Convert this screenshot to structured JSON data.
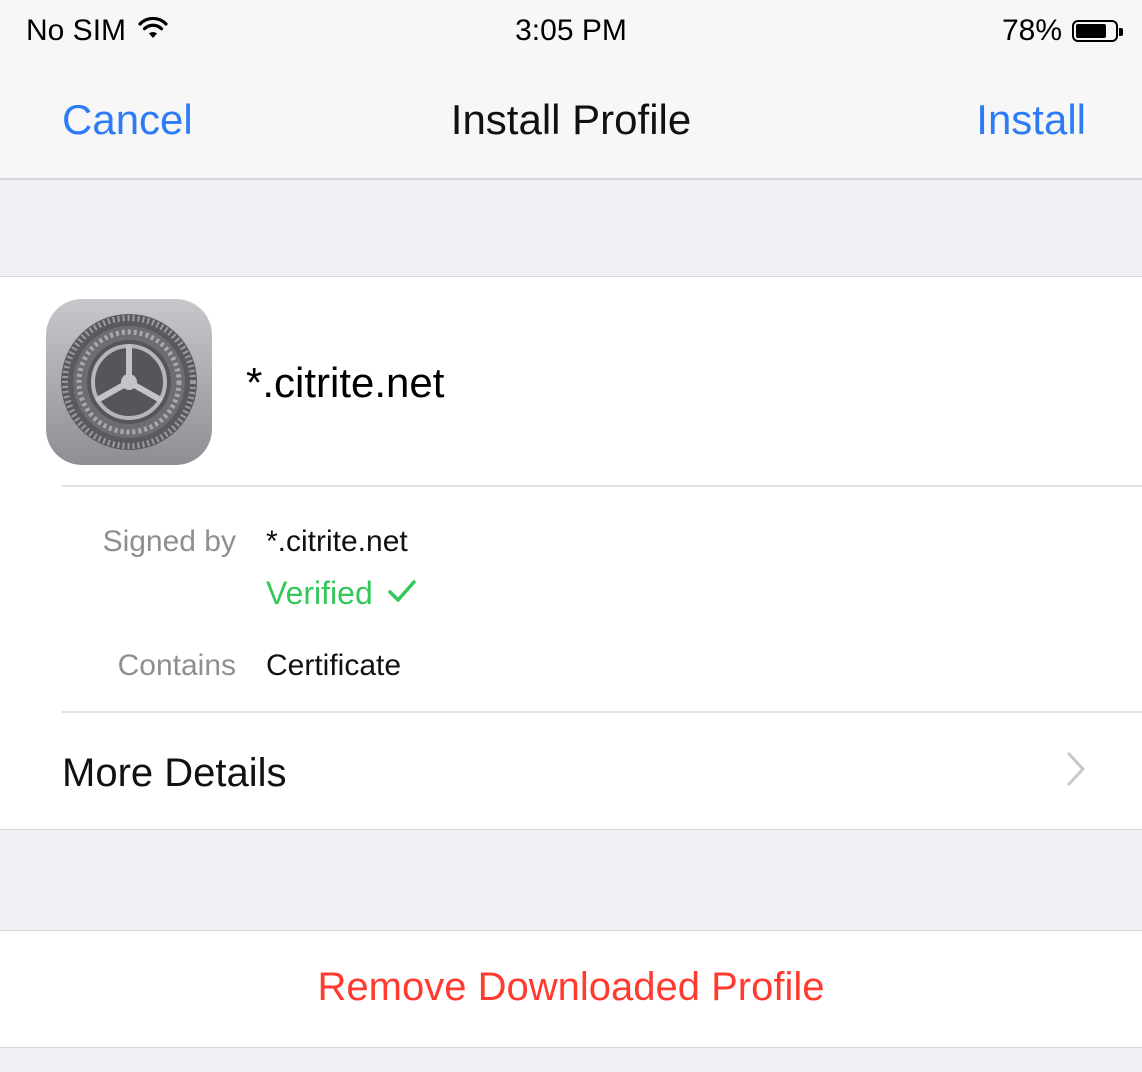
{
  "status_bar": {
    "carrier": "No SIM",
    "time": "3:05 PM",
    "battery_percent": "78%",
    "battery_level": 0.78,
    "wifi_icon": "wifi-icon"
  },
  "nav": {
    "cancel_label": "Cancel",
    "title": "Install Profile",
    "install_label": "Install",
    "accent_color": "#2d7cf6"
  },
  "profile": {
    "name": "*.citrite.net",
    "icon": "settings-gear-icon",
    "signed_by_label": "Signed by",
    "signed_by_value": "*.citrite.net",
    "verified_label": "Verified",
    "verified_color": "#34c759",
    "contains_label": "Contains",
    "contains_value": "Certificate",
    "more_details_label": "More Details"
  },
  "actions": {
    "remove_label": "Remove Downloaded Profile",
    "remove_color": "#ff3b30"
  }
}
